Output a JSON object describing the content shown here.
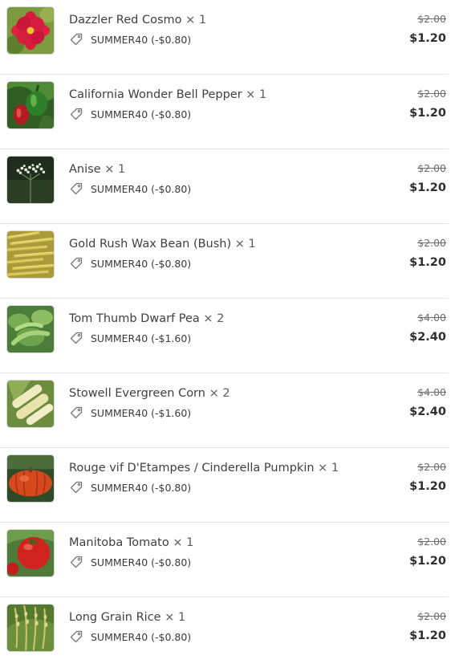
{
  "cart": {
    "items": [
      {
        "title": "Dazzler Red Cosmo",
        "qty": "× 1",
        "discount": "SUMMER40 (-$0.80)",
        "price_original": "$2.00",
        "price_final": "$1.20",
        "image_icon": "red-cosmo-flower-image"
      },
      {
        "title": "California Wonder Bell Pepper",
        "qty": "× 1",
        "discount": "SUMMER40 (-$0.80)",
        "price_original": "$2.00",
        "price_final": "$1.20",
        "image_icon": "bell-pepper-image"
      },
      {
        "title": "Anise",
        "qty": "× 1",
        "discount": "SUMMER40 (-$0.80)",
        "price_original": "$2.00",
        "price_final": "$1.20",
        "image_icon": "anise-flower-image"
      },
      {
        "title": "Gold Rush Wax Bean (Bush)",
        "qty": "× 1",
        "discount": "SUMMER40 (-$0.80)",
        "price_original": "$2.00",
        "price_final": "$1.20",
        "image_icon": "wax-bean-image"
      },
      {
        "title": "Tom Thumb Dwarf Pea",
        "qty": "× 2",
        "discount": "SUMMER40 (-$1.60)",
        "price_original": "$4.00",
        "price_final": "$2.40",
        "image_icon": "pea-pod-image"
      },
      {
        "title": "Stowell Evergreen Corn",
        "qty": "× 2",
        "discount": "SUMMER40 (-$1.60)",
        "price_original": "$4.00",
        "price_final": "$2.40",
        "image_icon": "corn-image"
      },
      {
        "title": "Rouge vif D'Etampes / Cinderella Pumpkin",
        "qty": "× 1",
        "discount": "SUMMER40 (-$0.80)",
        "price_original": "$2.00",
        "price_final": "$1.20",
        "image_icon": "pumpkin-image"
      },
      {
        "title": "Manitoba Tomato",
        "qty": "× 1",
        "discount": "SUMMER40 (-$0.80)",
        "price_original": "$2.00",
        "price_final": "$1.20",
        "image_icon": "tomato-image"
      },
      {
        "title": "Long Grain Rice",
        "qty": "× 1",
        "discount": "SUMMER40 (-$0.80)",
        "price_original": "$2.00",
        "price_final": "$1.20",
        "image_icon": "rice-image"
      }
    ]
  },
  "icons": {
    "discount": "tag-icon"
  },
  "colors": {
    "text": "#3d3d3d",
    "divider": "#e3e3e3",
    "strike_price": "#6e6e6e"
  }
}
